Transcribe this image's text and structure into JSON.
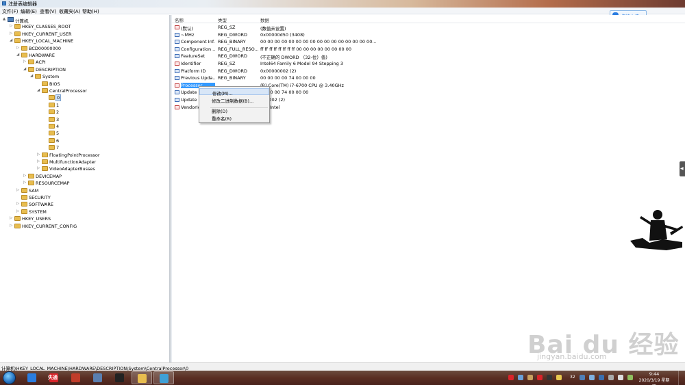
{
  "window": {
    "title": "注册表编辑器"
  },
  "menu": [
    "文件(F)",
    "编辑(E)",
    "查看(V)",
    "收藏夹(A)",
    "帮助(H)"
  ],
  "upload_button": {
    "label": "拖拽上传"
  },
  "tree": [
    {
      "label": "计算机",
      "depth": 0,
      "exp": "▲",
      "icon": "computer"
    },
    {
      "label": "HKEY_CLASSES_ROOT",
      "depth": 1,
      "exp": "▷"
    },
    {
      "label": "HKEY_CURRENT_USER",
      "depth": 1,
      "exp": "▷"
    },
    {
      "label": "HKEY_LOCAL_MACHINE",
      "depth": 1,
      "exp": "◢"
    },
    {
      "label": "BCD00000000",
      "depth": 2,
      "exp": "▷"
    },
    {
      "label": "HARDWARE",
      "depth": 2,
      "exp": "◢"
    },
    {
      "label": "ACPI",
      "depth": 3,
      "exp": "▷"
    },
    {
      "label": "DESCRIPTION",
      "depth": 3,
      "exp": "◢"
    },
    {
      "label": "System",
      "depth": 4,
      "exp": "◢"
    },
    {
      "label": "BIOS",
      "depth": 5,
      "exp": ""
    },
    {
      "label": "CentralProcessor",
      "depth": 5,
      "exp": "◢"
    },
    {
      "label": "0",
      "depth": 6,
      "exp": "",
      "selected": true
    },
    {
      "label": "1",
      "depth": 6,
      "exp": ""
    },
    {
      "label": "2",
      "depth": 6,
      "exp": ""
    },
    {
      "label": "3",
      "depth": 6,
      "exp": ""
    },
    {
      "label": "4",
      "depth": 6,
      "exp": ""
    },
    {
      "label": "5",
      "depth": 6,
      "exp": ""
    },
    {
      "label": "6",
      "depth": 6,
      "exp": ""
    },
    {
      "label": "7",
      "depth": 6,
      "exp": ""
    },
    {
      "label": "FloatingPointProcessor",
      "depth": 5,
      "exp": "▷"
    },
    {
      "label": "MultifunctionAdapter",
      "depth": 5,
      "exp": "▷"
    },
    {
      "label": "VideoAdapterBusses",
      "depth": 5,
      "exp": "▷"
    },
    {
      "label": "DEVICEMAP",
      "depth": 3,
      "exp": "▷"
    },
    {
      "label": "RESOURCEMAP",
      "depth": 3,
      "exp": "▷"
    },
    {
      "label": "SAM",
      "depth": 2,
      "exp": "▷"
    },
    {
      "label": "SECURITY",
      "depth": 2,
      "exp": ""
    },
    {
      "label": "SOFTWARE",
      "depth": 2,
      "exp": "▷"
    },
    {
      "label": "SYSTEM",
      "depth": 2,
      "exp": "▷"
    },
    {
      "label": "HKEY_USERS",
      "depth": 1,
      "exp": "▷"
    },
    {
      "label": "HKEY_CURRENT_CONFIG",
      "depth": 1,
      "exp": "▷"
    }
  ],
  "columns": {
    "name": "名称",
    "type": "类型",
    "data": "数据"
  },
  "values": [
    {
      "name": "(默认)",
      "type": "REG_SZ",
      "data": "(数值未设置)",
      "icon": "string"
    },
    {
      "name": "~MHz",
      "type": "REG_DWORD",
      "data": "0x00000d50 (3408)",
      "icon": "binary"
    },
    {
      "name": "Component Inf...",
      "type": "REG_BINARY",
      "data": "00 00 00 00 00 00 00 00 00 00 00 00 00 00 00 00...",
      "icon": "binary"
    },
    {
      "name": "Configuration ...",
      "type": "REG_FULL_RESO...",
      "data": "ff ff ff ff ff ff ff ff 00 00 00 00 00 00 00 00",
      "icon": "binary"
    },
    {
      "name": "FeatureSet",
      "type": "REG_DWORD",
      "data": "(不正确的 DWORD （32-位）值)",
      "icon": "binary"
    },
    {
      "name": "Identifier",
      "type": "REG_SZ",
      "data": "Intel64 Family 6 Model 94 Stepping 3",
      "icon": "string"
    },
    {
      "name": "Platform ID",
      "type": "REG_DWORD",
      "data": "0x00000002 (2)",
      "icon": "binary"
    },
    {
      "name": "Previous Upda...",
      "type": "REG_BINARY",
      "data": "00 00 00 00 74 00 00 00",
      "icon": "binary"
    },
    {
      "name": "Processor",
      "type": "",
      "data": "(R) Core(TM) i7-6700 CPU @ 3.40GHz",
      "icon": "string",
      "selected": true
    },
    {
      "name": "Update S",
      "type": "",
      "data": "00 00 00 74 00 00 00",
      "icon": "binary"
    },
    {
      "name": "Update S",
      "type": "",
      "data": "000002 (2)",
      "icon": "binary"
    },
    {
      "name": "VendorId",
      "type": "",
      "data": "uineIntel",
      "icon": "string"
    }
  ],
  "context_menu": {
    "items": [
      "修改(M)...",
      "修改二进制数据(B)...",
      "删除(D)",
      "重命名(R)"
    ]
  },
  "status": {
    "path": "计算机\\HKEY_LOCAL_MACHINE\\HARDWARE\\DESCRIPTION\\System\\CentralProcessor\\0"
  },
  "taskbar": {
    "apps": [
      {
        "name": "browser",
        "color": "#2a7de0",
        "text": ""
      },
      {
        "name": "player",
        "color": "#d9242a",
        "text": "失通"
      },
      {
        "name": "app3",
        "color": "#c13c2a",
        "text": ""
      },
      {
        "name": "documents",
        "color": "#5a7fb0",
        "text": ""
      },
      {
        "name": "qq",
        "color": "#222222",
        "text": ""
      },
      {
        "name": "explorer",
        "color": "#e8bd4f",
        "text": ""
      },
      {
        "name": "regedit",
        "color": "#3fa0d6",
        "text": ""
      }
    ],
    "tray_num": "32",
    "time": "9:44",
    "date": "2020/3/19 星期四"
  },
  "watermark": {
    "brand": "Bai du 经验",
    "url": "jingyan.baidu.com"
  },
  "colors": {
    "selection": "#3399ff",
    "folder": "#e8bd4f",
    "titlebar_right": "#6d3b30"
  }
}
